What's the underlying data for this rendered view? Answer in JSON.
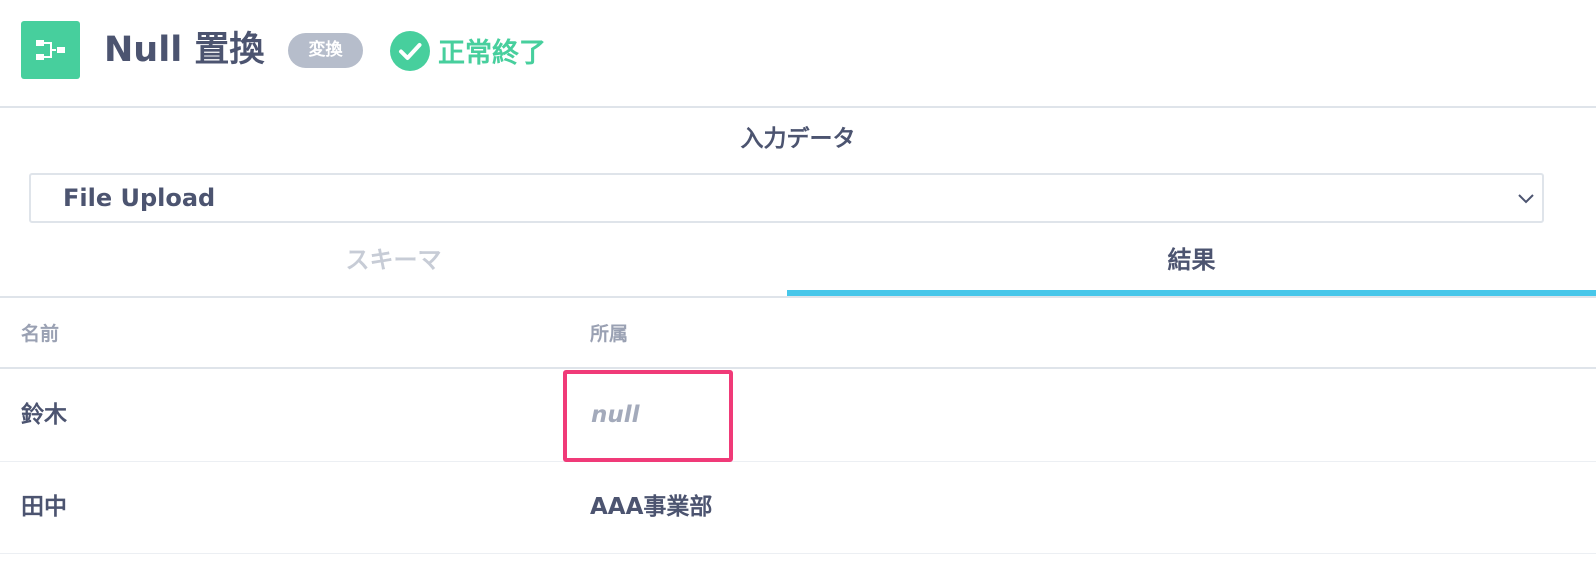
{
  "header": {
    "app_icon": "flow-node-icon",
    "title": "Null 置換",
    "badge": "変換",
    "status": {
      "icon": "check-circle-icon",
      "label": "正常終了",
      "color": "#47cf9d"
    }
  },
  "input_section": {
    "title": "入力データ",
    "select": {
      "value": "File Upload",
      "icon": "chevron-down-icon"
    }
  },
  "tabs": [
    {
      "label": "スキーマ",
      "active": false
    },
    {
      "label": "結果",
      "active": true
    }
  ],
  "table": {
    "columns": [
      "名前",
      "所属"
    ],
    "rows": [
      [
        "鈴木",
        "null"
      ],
      [
        "田中",
        "AAA事業部"
      ]
    ]
  },
  "colors": {
    "accent_green": "#47cf9d",
    "tab_underline": "#47c7ea",
    "highlight": "#f03a78"
  }
}
